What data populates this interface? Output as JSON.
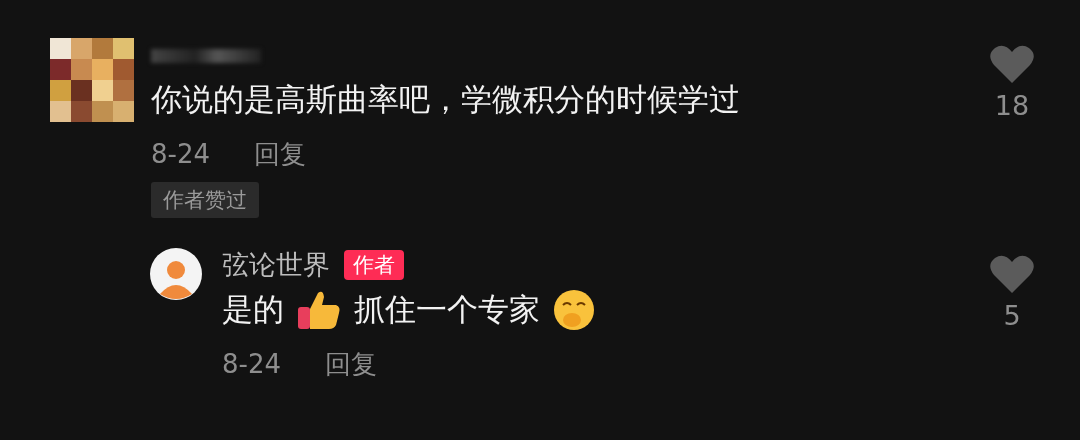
{
  "comments": [
    {
      "kind": "comment",
      "avatar": {
        "kind": "mosaic"
      },
      "content": [
        "你说的是高斯曲率吧，学微积分的时候学过"
      ],
      "date": "8-24",
      "reply": "回复",
      "badge": "作者赞过",
      "likes": "18",
      "liked": false
    },
    {
      "kind": "reply",
      "avatar": {
        "kind": "figure"
      },
      "name": "弦论世界",
      "author_tag": "作者",
      "content": [
        {
          "kind": "text",
          "text": "是的"
        },
        {
          "kind": "thumbs"
        },
        {
          "kind": "text",
          "text": "抓住一个专家"
        },
        {
          "kind": "face"
        }
      ],
      "date": "8-24",
      "reply": "回复",
      "likes": "5",
      "liked": false
    }
  ]
}
